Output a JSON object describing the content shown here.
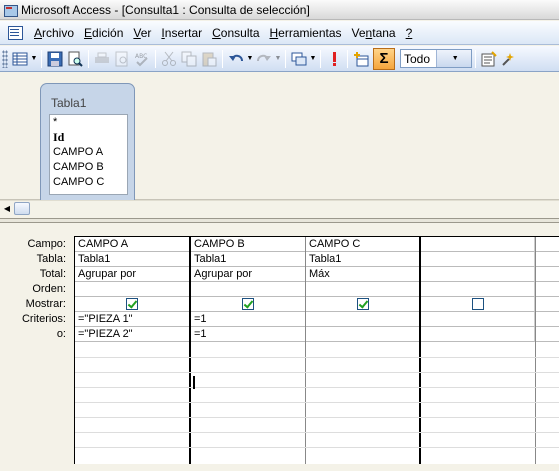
{
  "window": {
    "title": "Microsoft Access - [Consulta1 : Consulta de selección]"
  },
  "menu": [
    {
      "label": "Archivo",
      "accel": "A",
      "rest": "rchivo"
    },
    {
      "label": "Edición",
      "accel": "E",
      "rest": "dición"
    },
    {
      "label": "Ver",
      "accel": "V",
      "rest": "er"
    },
    {
      "label": "Insertar",
      "accel": "I",
      "rest": "nsertar"
    },
    {
      "label": "Consulta",
      "accel": "C",
      "rest": "onsulta"
    },
    {
      "label": "Herramientas",
      "accel": "H",
      "rest": "erramientas"
    },
    {
      "label": "Ventana",
      "accel": "n",
      "pre": "Ve",
      "rest": "tana"
    },
    {
      "label": "?",
      "accel": "?",
      "rest": ""
    }
  ],
  "toolbar": {
    "top_values_combo": "Todo",
    "icons": [
      "view-icon",
      "save-icon",
      "print-preview-search-icon",
      "print-icon",
      "preview-icon",
      "spelling-icon",
      "cut-icon",
      "copy-icon",
      "paste-icon",
      "undo-icon",
      "redo-icon",
      "query-type-icon",
      "run-icon",
      "show-table-icon",
      "totals-icon",
      "properties-icon",
      "build-icon"
    ]
  },
  "table_box": {
    "title": "Tabla1",
    "fields": [
      "*",
      "Id",
      "CAMPO A",
      "CAMPO B",
      "CAMPO C"
    ]
  },
  "grid": {
    "row_labels": [
      "Campo:",
      "Tabla:",
      "Total:",
      "Orden:",
      "Mostrar:",
      "Criterios:",
      "o:"
    ],
    "columns": [
      {
        "campo": "CAMPO A",
        "tabla": "Tabla1",
        "total": "Agrupar por",
        "orden": "",
        "mostrar": true,
        "criterios": "=\"PIEZA 1\"",
        "o": "=\"PIEZA 2\""
      },
      {
        "campo": "CAMPO B",
        "tabla": "Tabla1",
        "total": "Agrupar por",
        "orden": "",
        "mostrar": true,
        "criterios": "=1",
        "o": "=1"
      },
      {
        "campo": "CAMPO C",
        "tabla": "Tabla1",
        "total": "Máx",
        "orden": "",
        "mostrar": true,
        "criterios": "",
        "o": ""
      },
      {
        "campo": "",
        "tabla": "",
        "total": "",
        "orden": "",
        "mostrar": false,
        "criterios": "",
        "o": ""
      },
      {
        "campo": "",
        "tabla": "",
        "total": "",
        "orden": "",
        "mostrar": false,
        "criterios": "",
        "o": ""
      }
    ]
  },
  "colors": {
    "menubar": "#dbe7f6",
    "table_header": "#c6d5e8",
    "check": "#21a121",
    "totals_button": "#f5a53c"
  }
}
